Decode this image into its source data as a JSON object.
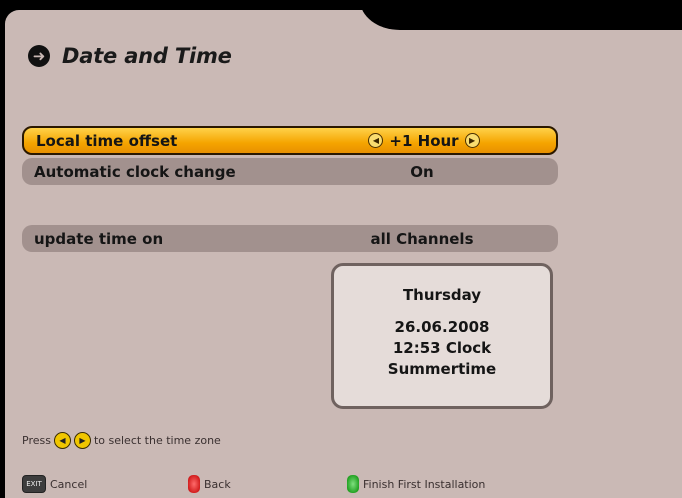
{
  "header": {
    "title": "Date and Time",
    "icon": "menu-arrow-icon"
  },
  "settings": [
    {
      "label": "Local time offset",
      "value": "+1 Hour",
      "selected": true
    },
    {
      "label": "Automatic clock change",
      "value": "On",
      "selected": false
    },
    {
      "label": "update time on",
      "value": "all Channels",
      "selected": false
    }
  ],
  "info": {
    "day": "Thursday",
    "date": "26.06.2008",
    "clock": "12:53 Clock",
    "dst": "Summertime"
  },
  "hint": {
    "prefix": "Press",
    "suffix": "to select the time zone"
  },
  "footer": {
    "exit_icon_text": "EXIT",
    "cancel": "Cancel",
    "back": "Back",
    "finish": "Finish First Installation"
  },
  "colors": {
    "panel": "#cab9b5",
    "row": "#a2918e",
    "highlight": "#f5a400",
    "red_key": "#c00000",
    "green_key": "#008a00"
  }
}
